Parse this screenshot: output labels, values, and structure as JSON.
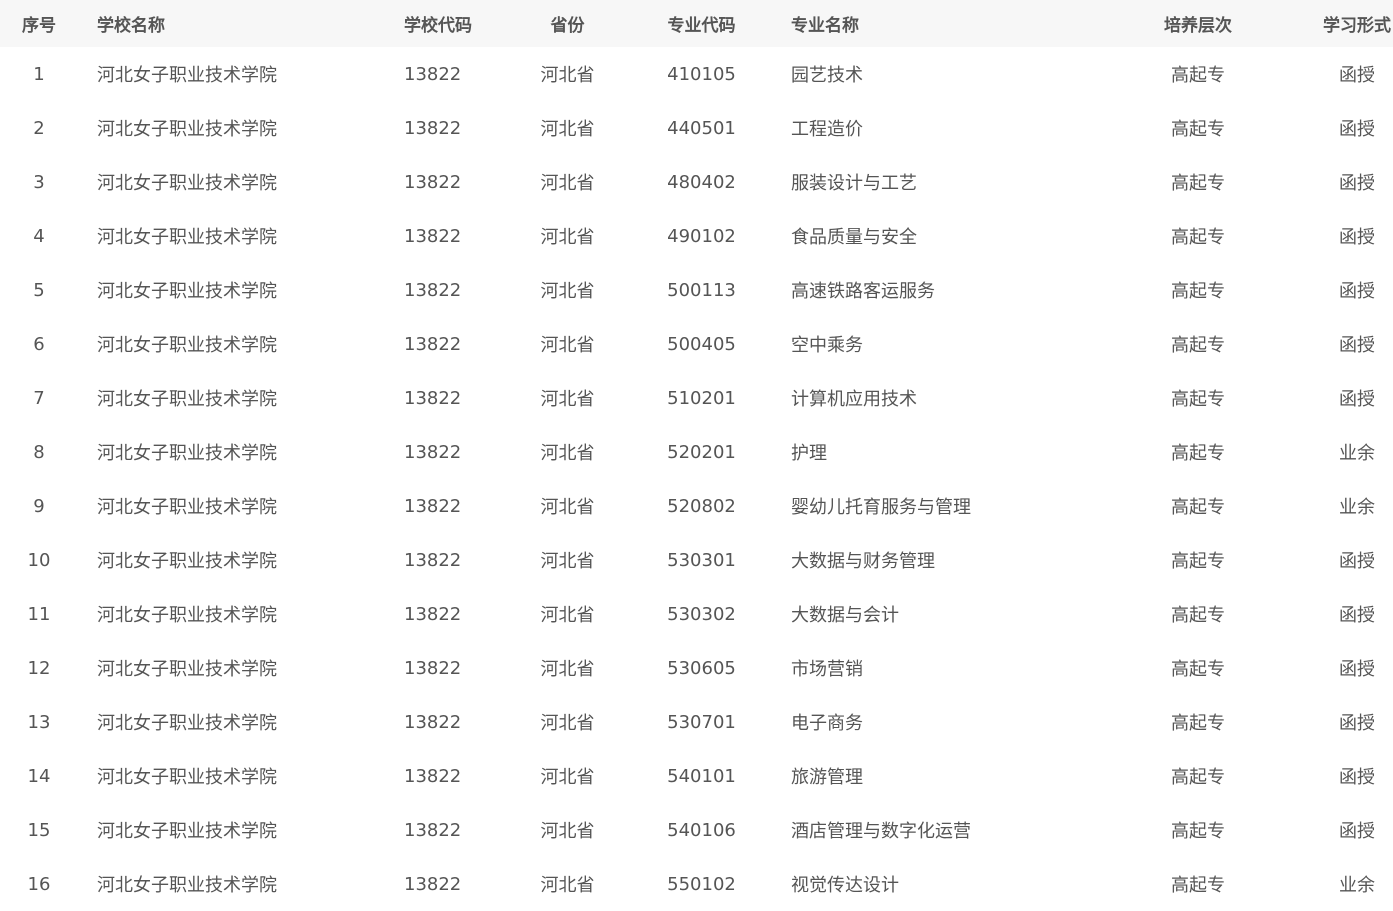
{
  "table": {
    "headers": {
      "seq": "序号",
      "school_name": "学校名称",
      "school_code": "学校代码",
      "province": "省份",
      "major_code": "专业代码",
      "major_name": "专业名称",
      "level": "培养层次",
      "study_mode": "学习形式"
    },
    "rows": [
      {
        "seq": "1",
        "school_name": "河北女子职业技术学院",
        "school_code": "13822",
        "province": "河北省",
        "major_code": "410105",
        "major_name": "园艺技术",
        "level": "高起专",
        "study_mode": "函授"
      },
      {
        "seq": "2",
        "school_name": "河北女子职业技术学院",
        "school_code": "13822",
        "province": "河北省",
        "major_code": "440501",
        "major_name": "工程造价",
        "level": "高起专",
        "study_mode": "函授"
      },
      {
        "seq": "3",
        "school_name": "河北女子职业技术学院",
        "school_code": "13822",
        "province": "河北省",
        "major_code": "480402",
        "major_name": "服装设计与工艺",
        "level": "高起专",
        "study_mode": "函授"
      },
      {
        "seq": "4",
        "school_name": "河北女子职业技术学院",
        "school_code": "13822",
        "province": "河北省",
        "major_code": "490102",
        "major_name": "食品质量与安全",
        "level": "高起专",
        "study_mode": "函授"
      },
      {
        "seq": "5",
        "school_name": "河北女子职业技术学院",
        "school_code": "13822",
        "province": "河北省",
        "major_code": "500113",
        "major_name": "高速铁路客运服务",
        "level": "高起专",
        "study_mode": "函授"
      },
      {
        "seq": "6",
        "school_name": "河北女子职业技术学院",
        "school_code": "13822",
        "province": "河北省",
        "major_code": "500405",
        "major_name": "空中乘务",
        "level": "高起专",
        "study_mode": "函授"
      },
      {
        "seq": "7",
        "school_name": "河北女子职业技术学院",
        "school_code": "13822",
        "province": "河北省",
        "major_code": "510201",
        "major_name": "计算机应用技术",
        "level": "高起专",
        "study_mode": "函授"
      },
      {
        "seq": "8",
        "school_name": "河北女子职业技术学院",
        "school_code": "13822",
        "province": "河北省",
        "major_code": "520201",
        "major_name": "护理",
        "level": "高起专",
        "study_mode": "业余"
      },
      {
        "seq": "9",
        "school_name": "河北女子职业技术学院",
        "school_code": "13822",
        "province": "河北省",
        "major_code": "520802",
        "major_name": "婴幼儿托育服务与管理",
        "level": "高起专",
        "study_mode": "业余"
      },
      {
        "seq": "10",
        "school_name": "河北女子职业技术学院",
        "school_code": "13822",
        "province": "河北省",
        "major_code": "530301",
        "major_name": "大数据与财务管理",
        "level": "高起专",
        "study_mode": "函授"
      },
      {
        "seq": "11",
        "school_name": "河北女子职业技术学院",
        "school_code": "13822",
        "province": "河北省",
        "major_code": "530302",
        "major_name": "大数据与会计",
        "level": "高起专",
        "study_mode": "函授"
      },
      {
        "seq": "12",
        "school_name": "河北女子职业技术学院",
        "school_code": "13822",
        "province": "河北省",
        "major_code": "530605",
        "major_name": "市场营销",
        "level": "高起专",
        "study_mode": "函授"
      },
      {
        "seq": "13",
        "school_name": "河北女子职业技术学院",
        "school_code": "13822",
        "province": "河北省",
        "major_code": "530701",
        "major_name": "电子商务",
        "level": "高起专",
        "study_mode": "函授"
      },
      {
        "seq": "14",
        "school_name": "河北女子职业技术学院",
        "school_code": "13822",
        "province": "河北省",
        "major_code": "540101",
        "major_name": "旅游管理",
        "level": "高起专",
        "study_mode": "函授"
      },
      {
        "seq": "15",
        "school_name": "河北女子职业技术学院",
        "school_code": "13822",
        "province": "河北省",
        "major_code": "540106",
        "major_name": "酒店管理与数字化运营",
        "level": "高起专",
        "study_mode": "函授"
      },
      {
        "seq": "16",
        "school_name": "河北女子职业技术学院",
        "school_code": "13822",
        "province": "河北省",
        "major_code": "550102",
        "major_name": "视觉传达设计",
        "level": "高起专",
        "study_mode": "业余"
      }
    ]
  },
  "colors": {
    "header_background": "#f7f7f7",
    "text": "#555555",
    "page_background": "#ffffff"
  }
}
